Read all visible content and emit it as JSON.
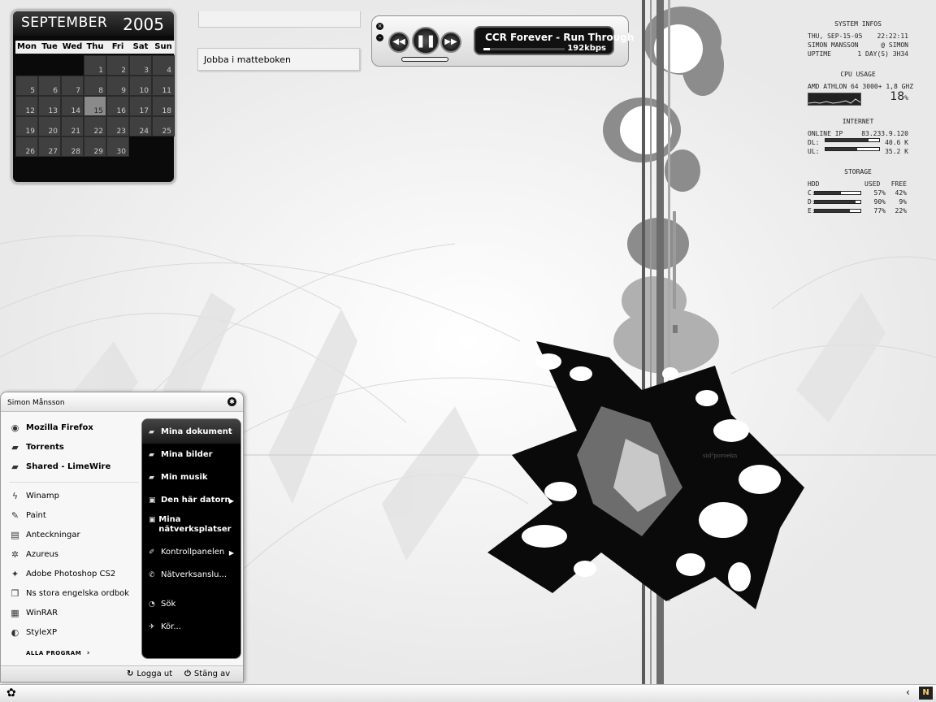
{
  "calendar": {
    "month": "SEPTEMBER",
    "year": "2005",
    "weekdays": [
      "Mon",
      "Tue",
      "Wed",
      "Thu",
      "Fri",
      "Sat",
      "Sun"
    ],
    "leading_blanks": 3,
    "days": [
      "1",
      "2",
      "3",
      "4",
      "5",
      "6",
      "7",
      "8",
      "9",
      "10",
      "11",
      "12",
      "13",
      "14",
      "15",
      "16",
      "17",
      "18",
      "19",
      "20",
      "21",
      "22",
      "23",
      "24",
      "25",
      "26",
      "27",
      "28",
      "29",
      "30"
    ],
    "today": "15"
  },
  "notes": {
    "note1": "Jobba i matteboken"
  },
  "player": {
    "track": "CCR Forever - Run Through",
    "bitrate": "192kbps",
    "close_glyph": "×",
    "min_glyph": "–",
    "prev_glyph": "◀◀",
    "pause_glyph": "❚❚",
    "next_glyph": "▶▶",
    "progress": 0.08
  },
  "sysinfo": {
    "header": "SYSTEM INFOS",
    "date": "THU, SEP-15-05",
    "time": "22:22:11",
    "user": "SIMON MANSSON",
    "host": "@ SIMON",
    "uptime_label": "UPTIME",
    "uptime": "1 DAY(S) 3H34",
    "cpu_header": "CPU USAGE",
    "cpu_name": "AMD ATHLON 64 3000+ 1,8 GHZ",
    "cpu_pct": "18",
    "cpu_pct_sign": "%",
    "internet_header": "INTERNET",
    "ip_label": "ONLINE IP",
    "ip": "83.233.9.120",
    "dl_label": "DL:",
    "dl": "40.6 K",
    "dl_fill": 0.8,
    "ul_label": "UL:",
    "ul": "35.2 K",
    "ul_fill": 0.6,
    "storage_header": "STORAGE",
    "storage_cols": [
      "HDD",
      "USED",
      "FREE"
    ],
    "drives": [
      {
        "label": "C:",
        "used": "57%",
        "free": "42%",
        "fill": 0.57
      },
      {
        "label": "D:",
        "used": "90%",
        "free": "9%",
        "fill": 0.9
      },
      {
        "label": "E:",
        "used": "77%",
        "free": "22%",
        "fill": 0.77
      }
    ]
  },
  "startmenu": {
    "user": "Simon Månsson",
    "pinned": [
      {
        "label": "Mozilla Firefox",
        "icon": "globe-icon",
        "glyph": "◉"
      },
      {
        "label": "Torrents",
        "icon": "folder-icon",
        "glyph": "▰"
      },
      {
        "label": "Shared - LimeWire",
        "icon": "folder-icon",
        "glyph": "▰"
      }
    ],
    "recent": [
      {
        "label": "Winamp",
        "icon": "winamp-icon",
        "glyph": "ϟ"
      },
      {
        "label": "Paint",
        "icon": "paint-icon",
        "glyph": "✎"
      },
      {
        "label": "Anteckningar",
        "icon": "notepad-icon",
        "glyph": "▤"
      },
      {
        "label": "Azureus",
        "icon": "azureus-icon",
        "glyph": "✲"
      },
      {
        "label": "Adobe Photoshop CS2",
        "icon": "photoshop-icon",
        "glyph": "✦"
      },
      {
        "label": "Ns stora engelska ordbok",
        "icon": "dictionary-icon",
        "glyph": "❐"
      },
      {
        "label": "WinRAR",
        "icon": "winrar-icon",
        "glyph": "▦"
      },
      {
        "label": "StyleXP",
        "icon": "stylexp-icon",
        "glyph": "◐"
      }
    ],
    "all_programs": "ALLA PROGRAM",
    "right": [
      {
        "label": "Mina dokument",
        "icon": "documents-icon",
        "glyph": "▰"
      },
      {
        "label": "Mina bilder",
        "icon": "pictures-icon",
        "glyph": "▰"
      },
      {
        "label": "Min musik",
        "icon": "music-icon",
        "glyph": "▰"
      },
      {
        "label": "Den här datorn",
        "icon": "computer-icon",
        "glyph": "▣"
      },
      {
        "label": "Mina nätverksplatser",
        "icon": "network-places-icon",
        "glyph": "▣"
      },
      {
        "label": "Kontrollpanelen",
        "icon": "control-panel-icon",
        "glyph": "✐"
      },
      {
        "label": "Nätverksanslu...",
        "icon": "network-connections-icon",
        "glyph": "✆"
      },
      {
        "label": "Sök",
        "icon": "search-icon",
        "glyph": "◔"
      },
      {
        "label": "Kör...",
        "icon": "run-icon",
        "glyph": "✈"
      }
    ],
    "logoff": "Logga ut",
    "shutdown": "Stäng av"
  },
  "wallpaper": {
    "signature": "sid³poroekn"
  },
  "colors": {
    "calendar_bg": "#0a0a0a",
    "menu_panel": "#000000",
    "desktop": "#f4f4f4"
  }
}
